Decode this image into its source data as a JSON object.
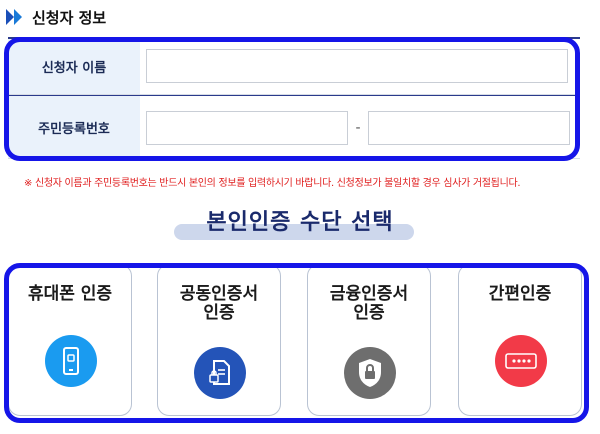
{
  "section": {
    "title": "신청자 정보",
    "icon": "double-arrow-icon"
  },
  "form": {
    "name_label": "신청자 이름",
    "name_value": "",
    "rrn_label": "주민등록번호",
    "rrn_front_value": "",
    "rrn_separator": "-",
    "rrn_back_value": ""
  },
  "notice": "※ 신청자 이름과 주민등록번호는 반드시 본인의 정보를 입력하시기 바랍니다. 신청정보가 불일치할 경우 심사가 거절됩니다.",
  "auth": {
    "title": "본인인증 수단 선택",
    "options": [
      {
        "label": "휴대폰 인증",
        "icon": "mobile-phone-icon",
        "color": "#1a9bf0"
      },
      {
        "label": "공동인증서\n인증",
        "icon": "certificate-document-icon",
        "color": "#2454b8"
      },
      {
        "label": "금융인증서\n인증",
        "icon": "shield-lock-icon",
        "color": "#6e6e6e"
      },
      {
        "label": "간편인증",
        "icon": "password-dots-icon",
        "color": "#f23a48"
      }
    ]
  },
  "colors": {
    "highlight": "#1515e8",
    "label_bg": "#eaf2fb",
    "notice": "#e02020",
    "title_bar": "#cdd7ec"
  }
}
